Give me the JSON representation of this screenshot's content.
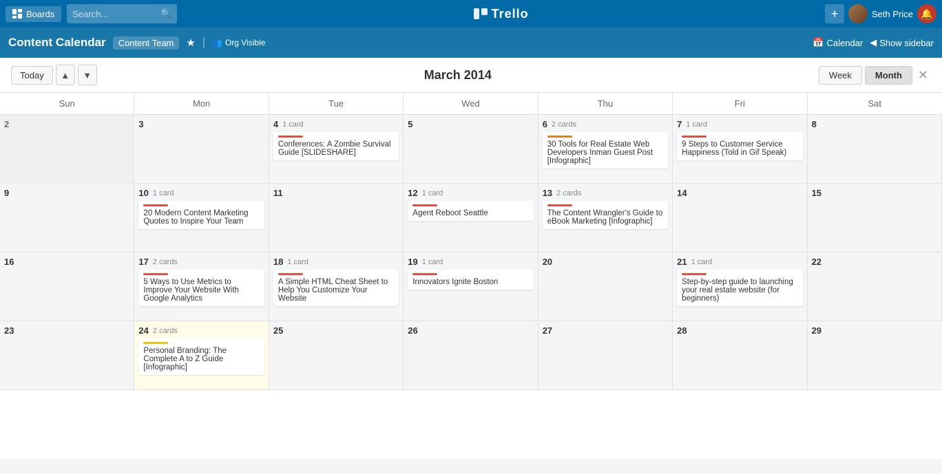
{
  "topnav": {
    "boards_label": "Boards",
    "search_placeholder": "Search...",
    "logo_text": "Trello",
    "add_label": "+",
    "username": "Seth Price"
  },
  "board": {
    "title": "Content Calendar",
    "team": "Content Team",
    "org": "Org Visible",
    "calendar_link": "Calendar",
    "show_sidebar": "Show sidebar"
  },
  "calendar": {
    "title": "March 2014",
    "today_label": "Today",
    "week_label": "Week",
    "month_label": "Month",
    "day_names": [
      "Sun",
      "Mon",
      "Tue",
      "Wed",
      "Thu",
      "Fri",
      "Sat"
    ],
    "weeks": [
      [
        {
          "date": "2",
          "cards": [],
          "card_count": "",
          "highlight": false,
          "prev": true
        },
        {
          "date": "3",
          "cards": [],
          "card_count": "",
          "highlight": false,
          "prev": false
        },
        {
          "date": "4",
          "cards": [
            {
              "title": "Conferences: A Zombie Survival Guide [SLIDESHARE]",
              "bar": "red"
            }
          ],
          "card_count": "1 card",
          "highlight": false
        },
        {
          "date": "5",
          "cards": [],
          "card_count": "",
          "highlight": false
        },
        {
          "date": "6",
          "cards": [
            {
              "title": "30 Tools for Real Estate Web Developers Inman Guest Post [Infographic]",
              "bar": "orange"
            }
          ],
          "card_count": "2 cards",
          "highlight": false
        },
        {
          "date": "7",
          "cards": [
            {
              "title": "9 Steps to Customer Service Happiness (Told in Gif Speak)",
              "bar": "red"
            }
          ],
          "card_count": "1 card",
          "highlight": false
        },
        {
          "date": "8",
          "cards": [],
          "card_count": "",
          "highlight": false
        }
      ],
      [
        {
          "date": "9",
          "cards": [],
          "card_count": "",
          "highlight": false
        },
        {
          "date": "10",
          "cards": [
            {
              "title": "20 Modern Content Marketing Quotes to Inspire Your Team",
              "bar": "red"
            }
          ],
          "card_count": "1 card",
          "highlight": false
        },
        {
          "date": "11",
          "cards": [],
          "card_count": "",
          "highlight": false
        },
        {
          "date": "12",
          "cards": [
            {
              "title": "Agent Reboot Seattle",
              "bar": "red"
            }
          ],
          "card_count": "1 card",
          "highlight": false
        },
        {
          "date": "13",
          "cards": [
            {
              "title": "The Content Wrangler's Guide to eBook Marketing [Infographic]",
              "bar": "red"
            }
          ],
          "card_count": "2 cards",
          "highlight": false
        },
        {
          "date": "14",
          "cards": [],
          "card_count": "",
          "highlight": false
        },
        {
          "date": "15",
          "cards": [],
          "card_count": "",
          "highlight": false
        }
      ],
      [
        {
          "date": "16",
          "cards": [],
          "card_count": "",
          "highlight": false
        },
        {
          "date": "17",
          "cards": [
            {
              "title": "5 Ways to Use Metrics to Improve Your Website With Google Analytics",
              "bar": "red"
            }
          ],
          "card_count": "2 cards",
          "highlight": false
        },
        {
          "date": "18",
          "cards": [
            {
              "title": "A Simple HTML Cheat Sheet to Help You Customize Your Website",
              "bar": "red"
            }
          ],
          "card_count": "1 card",
          "highlight": false
        },
        {
          "date": "19",
          "cards": [
            {
              "title": "Innovators Ignite Boston",
              "bar": "red"
            }
          ],
          "card_count": "1 card",
          "highlight": false
        },
        {
          "date": "20",
          "cards": [],
          "card_count": "",
          "highlight": false
        },
        {
          "date": "21",
          "cards": [
            {
              "title": "Step-by-step guide to launching your real estate website (for beginners)",
              "bar": "red"
            }
          ],
          "card_count": "1 card",
          "highlight": false
        },
        {
          "date": "22",
          "cards": [],
          "card_count": "",
          "highlight": false
        }
      ],
      [
        {
          "date": "23",
          "cards": [],
          "card_count": "",
          "highlight": false
        },
        {
          "date": "24",
          "cards": [
            {
              "title": "Personal Branding: The Complete A to Z Guide [Infographic]",
              "bar": "yellow"
            }
          ],
          "card_count": "2 cards",
          "highlight": true
        },
        {
          "date": "25",
          "cards": [],
          "card_count": "",
          "highlight": false
        },
        {
          "date": "26",
          "cards": [],
          "card_count": "",
          "highlight": false
        },
        {
          "date": "27",
          "cards": [],
          "card_count": "",
          "highlight": false
        },
        {
          "date": "28",
          "cards": [],
          "card_count": "",
          "highlight": false
        },
        {
          "date": "29",
          "cards": [],
          "card_count": "",
          "highlight": false
        }
      ]
    ]
  }
}
